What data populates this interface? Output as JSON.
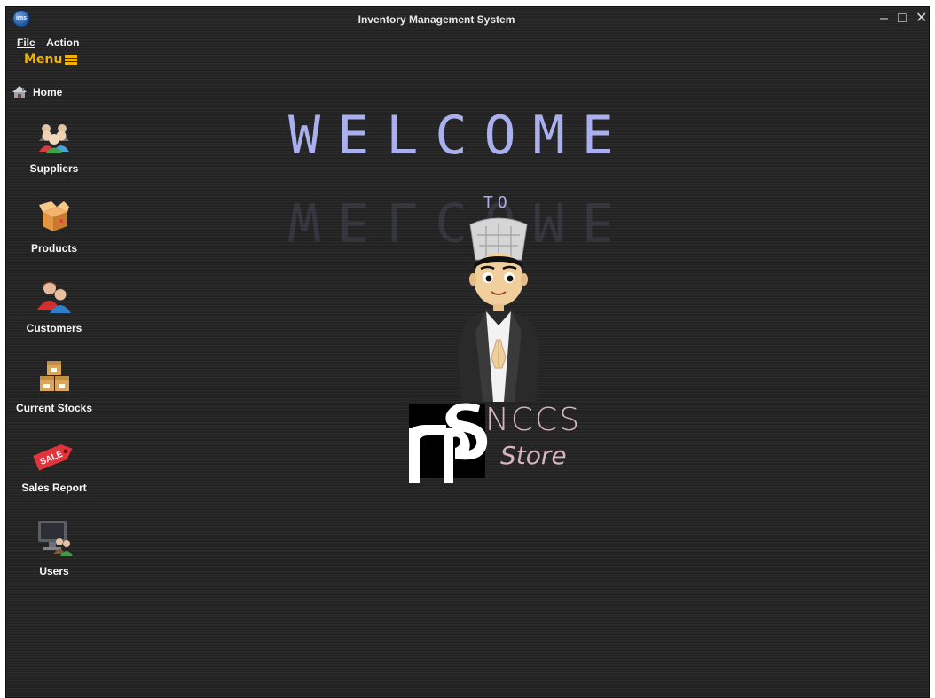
{
  "window": {
    "title": "Inventory Management System",
    "app_icon_text": "ims",
    "controls": {
      "minimize": "–",
      "maximize": "□",
      "close": "✕"
    }
  },
  "menubar": {
    "file_label": "File",
    "action_label": "Action"
  },
  "sidebar": {
    "toggle_label": "Menu",
    "home_label": "Home",
    "items": [
      {
        "label": "Suppliers",
        "icon": "suppliers-icon"
      },
      {
        "label": "Products",
        "icon": "products-icon"
      },
      {
        "label": "Customers",
        "icon": "customers-icon"
      },
      {
        "label": "Current Stocks",
        "icon": "stocks-icon"
      },
      {
        "label": "Sales Report",
        "icon": "sales-icon"
      },
      {
        "label": "Users",
        "icon": "users-icon"
      }
    ]
  },
  "main": {
    "welcome_text": "WELCOME",
    "to_text": "TO",
    "brand_name": "NCCS",
    "brand_subtitle": "Store",
    "sale_tag_text": "SALE"
  },
  "colors": {
    "background": "#262626",
    "welcome": "#aab0ee",
    "brand": "#d7b3c0",
    "menu_accent": "#f0b400"
  }
}
